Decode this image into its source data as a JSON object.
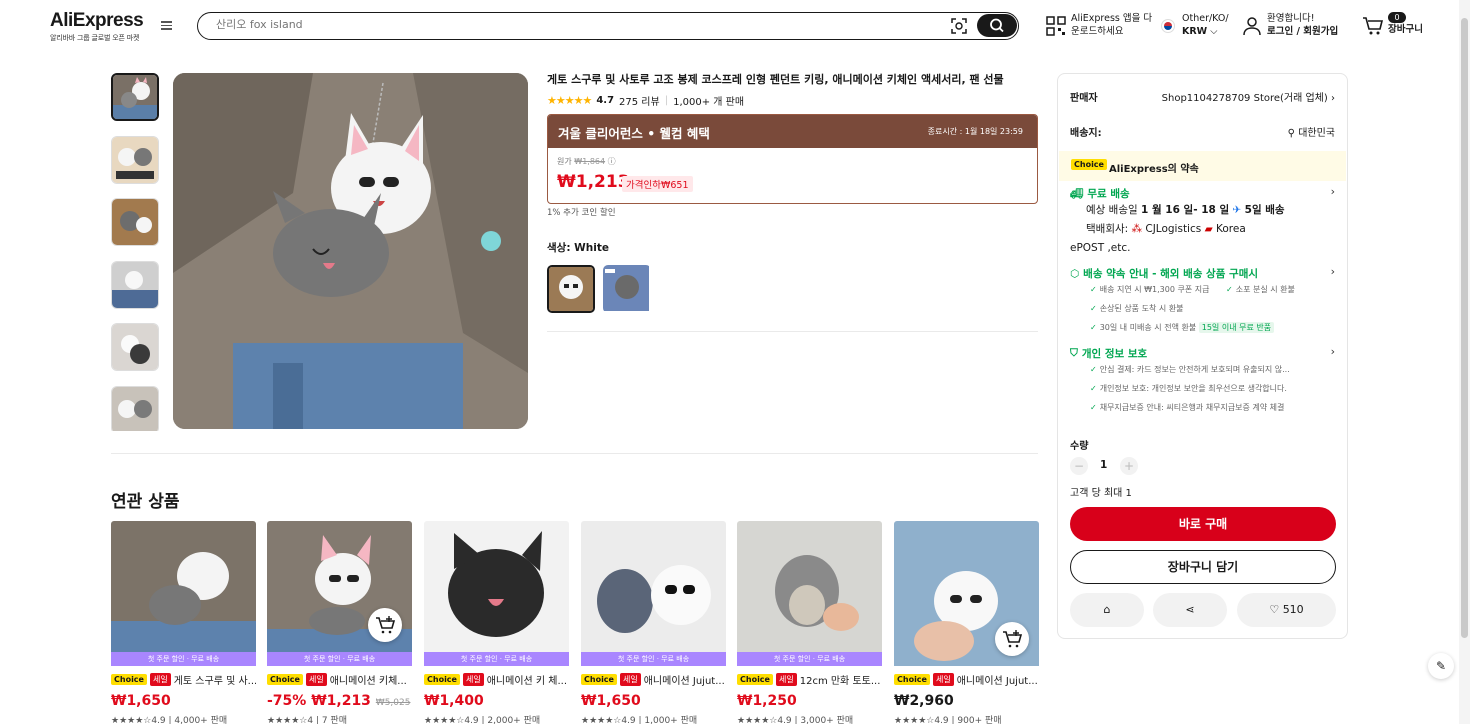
{
  "header": {
    "logo": "AliExpress",
    "logo_sub": "알리바바 그룹 글로벌 오픈 마켓",
    "search_placeholder": "산리오 fox island",
    "app_line1": "AliExpress 앱을 다",
    "app_line2": "운로드하세요",
    "region_line1": "Other/KO/",
    "region_line2": "KRW",
    "account_line1": "환영합니다!",
    "account_line2": "로그인 / 회원가입",
    "cart_label": "장바구니",
    "cart_count": "0"
  },
  "product": {
    "title": "게토 스구루 및 사토루 고조 봉제 코스프레 인형 펜던트 키링, 애니메이션 키체인 액세서리, 팬 선물",
    "rating": "4.7",
    "reviews": "275 리뷰",
    "sold": "1,000+ 개 판매",
    "promo_title": "겨울 클리어런스 • 웰컴 혜택",
    "promo_timer": "종료시간 : 1월 18일 23:59",
    "orig_label": "원가",
    "orig_price": "₩1,864",
    "price": "₩1,213",
    "discount": "가격인하₩651",
    "coin": "1% 추가 코인 할인",
    "color_label": "색상: White"
  },
  "related": {
    "title": "연관 상품",
    "items": [
      {
        "band": "첫 주문 할인 · 무료 배송",
        "sale": "세일",
        "name": "게토 스구루 및 사...",
        "price": "₩1,650",
        "old": "",
        "rating": "★★★★☆4.9 | 4,000+ 판매"
      },
      {
        "band": "첫 주문 할인 · 무료 배송",
        "sale": "세일",
        "name": "애니메이션 키체...",
        "price": "-75% ₩1,213",
        "old": "₩5,025",
        "rating": "★★★★☆4 | 7 판매"
      },
      {
        "band": "첫 주문 할인 · 무료 배송",
        "sale": "세일",
        "name": "애니메이션 키 체...",
        "price": "₩1,400",
        "old": "",
        "rating": "★★★★☆4.9 | 2,000+ 판매"
      },
      {
        "band": "첫 주문 할인 · 무료 배송",
        "sale": "세일",
        "name": "애니메이션 Jujut...",
        "price": "₩1,650",
        "old": "",
        "rating": "★★★★☆4.9 | 1,000+ 판매"
      },
      {
        "band": "첫 주문 할인 · 무료 배송",
        "sale": "세일",
        "name": "12cm 만화 토토...",
        "price": "₩1,250",
        "old": "",
        "rating": "★★★★☆4.9 | 3,000+ 판매"
      },
      {
        "band": "",
        "sale": "세일",
        "name": "애니메이션 Jujut...",
        "price": "₩2,960",
        "old": "",
        "rating": "★★★★☆4.9 | 900+ 판매"
      }
    ],
    "choice": "Choice"
  },
  "panel": {
    "seller_label": "판매자",
    "seller_value": "Shop1104278709 Store(거래 업체)",
    "ship_label": "배송지:",
    "ship_value": "대한민국",
    "choice_tag": "Choice",
    "choice_promise": "AliExpress의 약속",
    "free_ship": "무료 배송",
    "ship_est_a": "예상 배송일 ",
    "ship_est_b": "1 월 16 일- 18 일",
    "ship_est_c": "5일 배송",
    "carrier_a": "택배회사:",
    "carrier_b": "CJLogistics",
    "carrier_c": "Korea",
    "carrier_d": "ePOST ,etc.",
    "delivery_h": "배송 약속 안내 - 해외 배송 상품 구매시",
    "d1": "배송 지연 시 ₩1,300 쿠폰 지급",
    "d2": "소포 분실 시 환불",
    "d3": "손상된 상품 도착 시 환불",
    "d4": "30일 내 미배송 시 전액 환불",
    "d4_tag": "15일 이내 무료 반품",
    "privacy_h": "개인 정보 보호",
    "p1": "안심 결제: 카드 정보는 안전하게 보호되며 유출되지 않...",
    "p2": "개인정보 보호: 개인정보 보안을 최우선으로 생각합니다.",
    "p3": "채무지급보증 안내: 씨티은행과 채무지급보증 계약 체결",
    "qty_label": "수량",
    "qty_value": "1",
    "limit": "고객 당 최대 1",
    "buy": "바로 구매",
    "add_cart": "장바구니 담기",
    "wish_count": "510"
  }
}
